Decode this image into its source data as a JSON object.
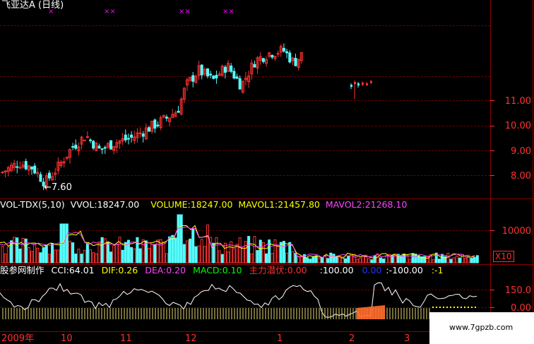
{
  "header": {
    "stock_title": "飞亚达A (日线)"
  },
  "colors": {
    "up": "#ff3232",
    "down": "#54ffff",
    "grid": "#8b0000",
    "axis": "#ff3030"
  },
  "price_panel": {
    "y_labels": [
      "11.00",
      "10.00",
      "9.00",
      "8.00"
    ],
    "low_marker": "←7.60",
    "top_markers": [
      "×",
      "××",
      "××",
      "××"
    ]
  },
  "volume_panel": {
    "indicator_name": "VOL-TDX(5,10)",
    "vvol": "VVOL:18247.00",
    "volume": "VOLUME:18247.00",
    "mavol1": "MAVOL1:21457.80",
    "mavol2": "MAVOL2:21268.10",
    "y_label": "10000",
    "unit": "X10"
  },
  "indicator_panel": {
    "maker": "股参网制作",
    "cci": "CCI:64.01",
    "dif": "DIF:0.26",
    "dea": "DEA:0.20",
    "macd": "MACD:0.10",
    "main_force": "主力潜伏:0.00",
    "v1": ":100.00",
    "v2": "0.00",
    "v3": ":-100.00",
    "v4": ":-1",
    "y_labels": [
      "150.0",
      "0.00"
    ]
  },
  "time_axis": {
    "labels": [
      "2009年",
      "10",
      "11",
      "12",
      "1",
      "2",
      "3"
    ]
  },
  "watermark": "www.7gpzb.com"
}
